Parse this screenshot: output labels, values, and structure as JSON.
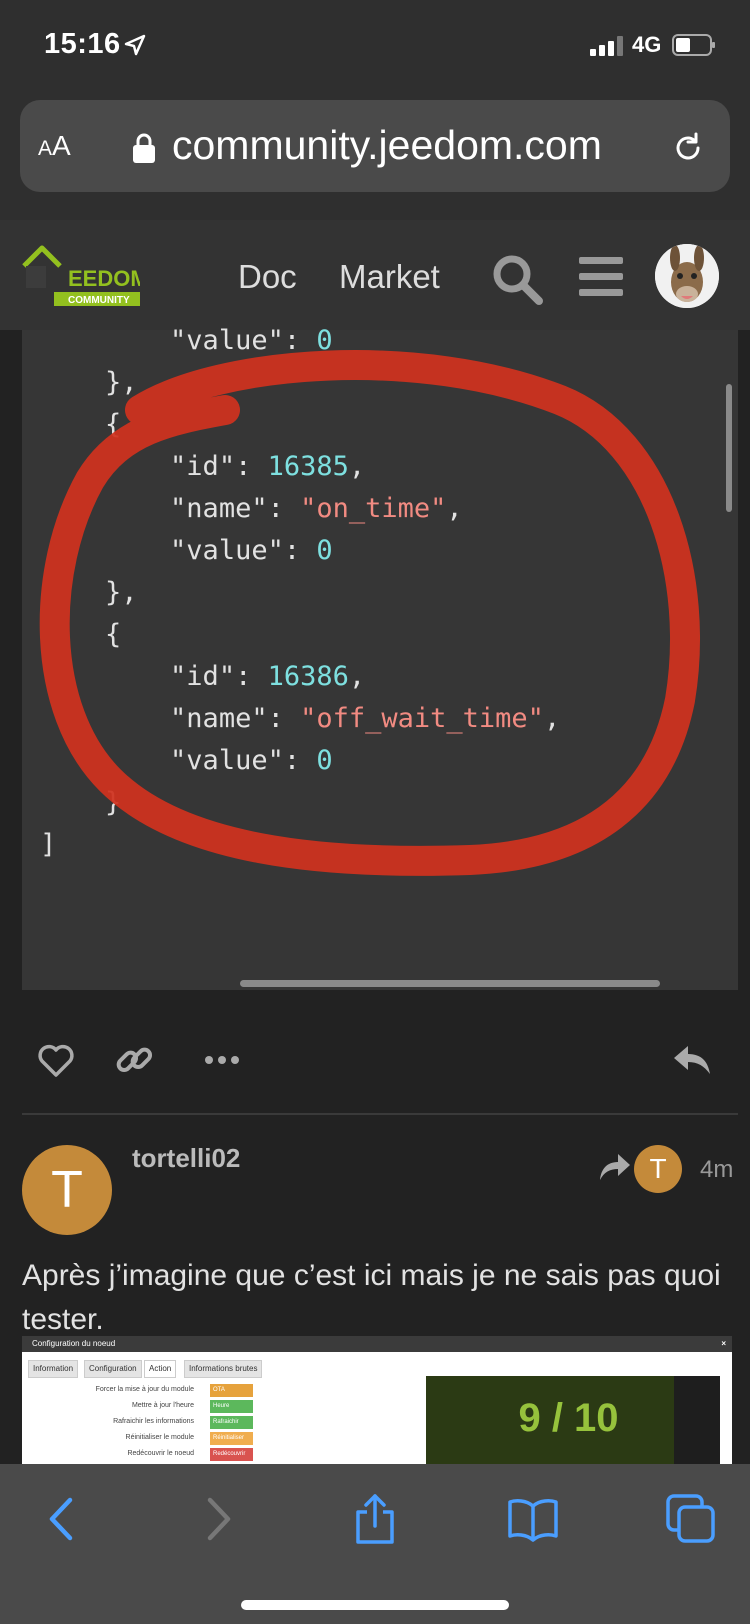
{
  "status": {
    "time": "15:16",
    "network": "4G"
  },
  "browser": {
    "aa_label_small": "A",
    "aa_label_large": "A",
    "url": "community.jeedom.com"
  },
  "site": {
    "logo_text": "EEDOM",
    "logo_sub": "COMMUNITY",
    "nav": {
      "doc": "Doc",
      "market": "Market"
    }
  },
  "code": {
    "lines": [
      {
        "indent": "        ",
        "key": "\"value\"",
        "sep": ": ",
        "val": "0",
        "type": "num",
        "tail": ""
      },
      {
        "indent": "    ",
        "text": "},",
        "type": "plain"
      },
      {
        "indent": "    ",
        "text": "{",
        "type": "plain"
      },
      {
        "indent": "        ",
        "key": "\"id\"",
        "sep": ": ",
        "val": "16385",
        "type": "num",
        "tail": ","
      },
      {
        "indent": "        ",
        "key": "\"name\"",
        "sep": ": ",
        "val": "\"on_time\"",
        "type": "str",
        "tail": ","
      },
      {
        "indent": "        ",
        "key": "\"value\"",
        "sep": ": ",
        "val": "0",
        "type": "num",
        "tail": ""
      },
      {
        "indent": "    ",
        "text": "},",
        "type": "plain"
      },
      {
        "indent": "    ",
        "text": "{",
        "type": "plain"
      },
      {
        "indent": "        ",
        "key": "\"id\"",
        "sep": ": ",
        "val": "16386",
        "type": "num",
        "tail": ","
      },
      {
        "indent": "        ",
        "key": "\"name\"",
        "sep": ": ",
        "val": "\"off_wait_time\"",
        "type": "str",
        "tail": ","
      },
      {
        "indent": "        ",
        "key": "\"value\"",
        "sep": ": ",
        "val": "0",
        "type": "num",
        "tail": ""
      },
      {
        "indent": "    ",
        "text": "}",
        "type": "plain"
      },
      {
        "indent": "",
        "text": "]",
        "type": "plain"
      }
    ],
    "annotation_color": "#d0321e"
  },
  "post": {
    "username": "tortelli02",
    "avatar_letter": "T",
    "reply_to_letter": "T",
    "time": "4m",
    "text": "Après j’imagine que c’est ici mais je ne sais pas quoi tester.",
    "avatar_color": "#c48a3a"
  },
  "embed": {
    "title": "Configuration du noeud",
    "close": "×",
    "tabs": [
      "Information",
      "Configuration",
      "Action",
      "Informations brutes"
    ],
    "rows": [
      {
        "label": "Forcer la mise à jour du module",
        "button": "OTA",
        "color": "#e6a23c"
      },
      {
        "label": "Mettre à jour l'heure",
        "button": "Heure",
        "color": "#5cb85c"
      },
      {
        "label": "Rafraichir les informations",
        "button": "Rafraichir",
        "color": "#5cb85c"
      },
      {
        "label": "Réinitialiser le module",
        "button": "Réinitialiser",
        "color": "#f0ad4e"
      },
      {
        "label": "Redécouvrir le noeud",
        "button": "Redécouvrir",
        "color": "#d9534f"
      }
    ],
    "score": "9 / 10"
  }
}
